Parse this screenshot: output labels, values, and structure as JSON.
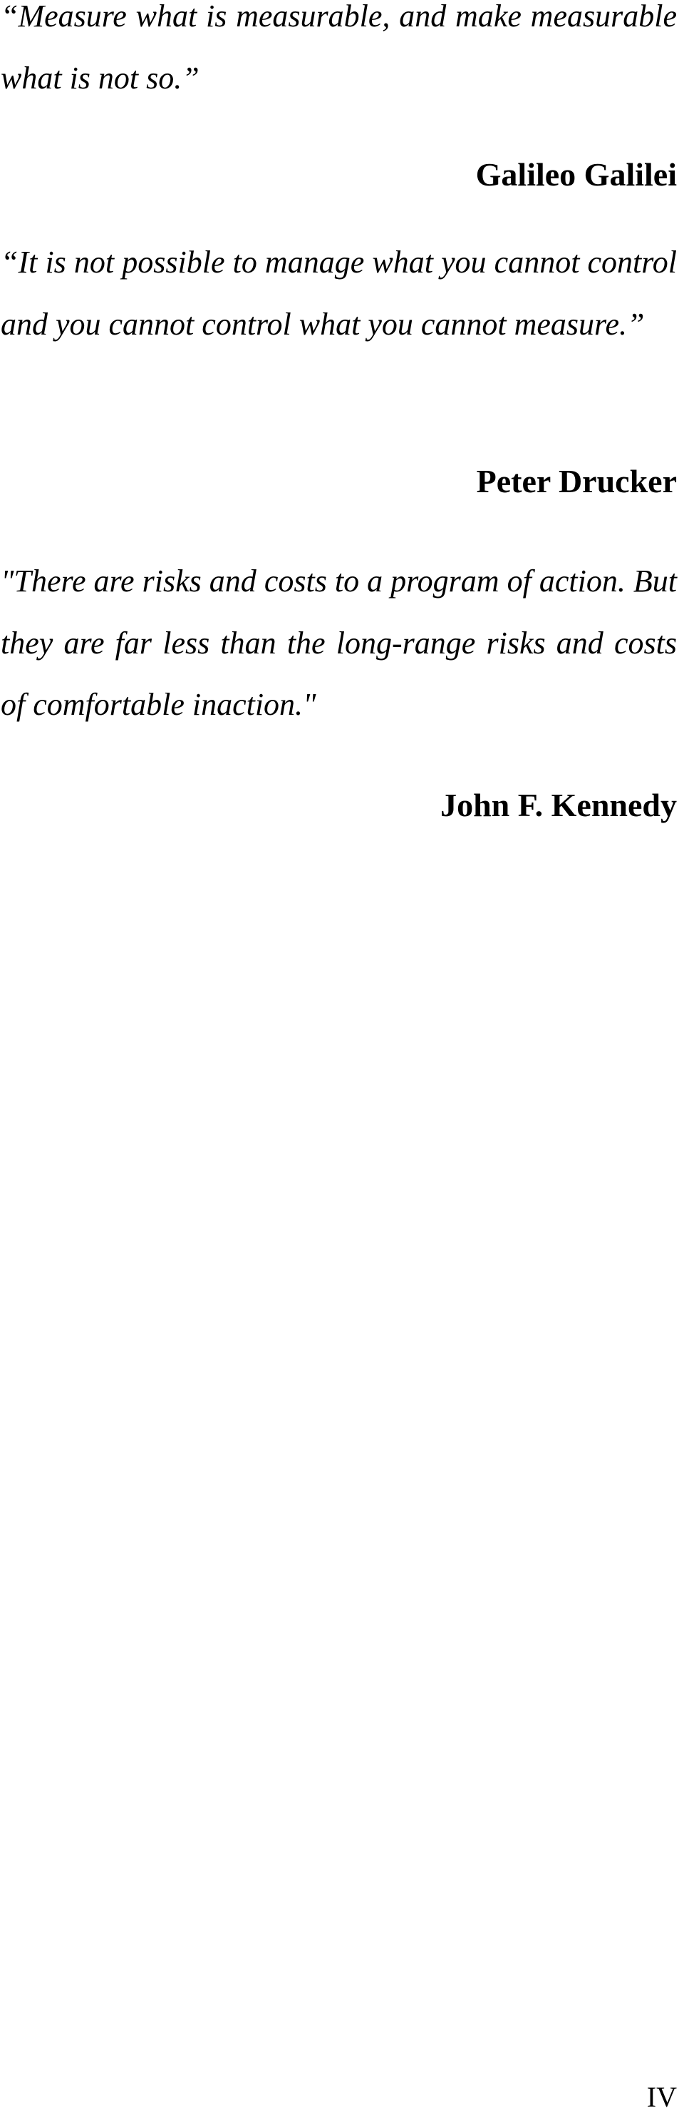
{
  "quotes": [
    {
      "text": "“Measure what is measurable, and make measurable what is not so.”",
      "author": "Galileo Galilei"
    },
    {
      "text": "“It is not possible to manage what you cannot control and you cannot control what you cannot measure.”",
      "author": "Peter Drucker"
    },
    {
      "text": "\"There are risks and costs to a program of action. But they are far less than the long-range risks and costs of comfortable inaction.\"",
      "author": "John F. Kennedy"
    }
  ],
  "page_number": "IV"
}
